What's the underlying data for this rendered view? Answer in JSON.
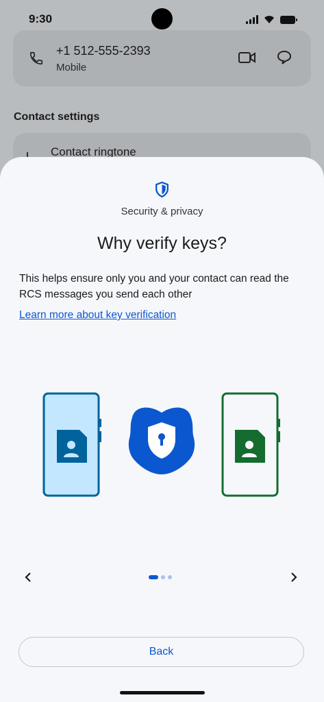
{
  "status_bar": {
    "time": "9:30"
  },
  "contact": {
    "phone_number": "+1 512-555-2393",
    "phone_type": "Mobile",
    "settings_title": "Contact settings",
    "ringtone_label": "Contact ringtone"
  },
  "sheet": {
    "eyebrow": "Security & privacy",
    "title": "Why verify keys?",
    "body": "This helps ensure only you and your contact can read the RCS messages you send each other",
    "link": "Learn more about key verification",
    "back_label": "Back"
  },
  "pager": {
    "current_page": 1,
    "total_pages": 3
  },
  "icons": {
    "top": "shield-icon",
    "left_phone": "contact-card-icon",
    "center": "lock-shield-icon",
    "right_phone": "contact-card-icon",
    "prev": "chevron-left-icon",
    "next": "chevron-right-icon"
  },
  "colors": {
    "accent": "#0b57d0",
    "left_phone_fill": "#c2e7ff",
    "left_phone_stroke": "#00639b",
    "right_phone_stroke": "#146c2e",
    "right_card": "#146c2e",
    "sheet_bg": "#f6f7fb"
  }
}
